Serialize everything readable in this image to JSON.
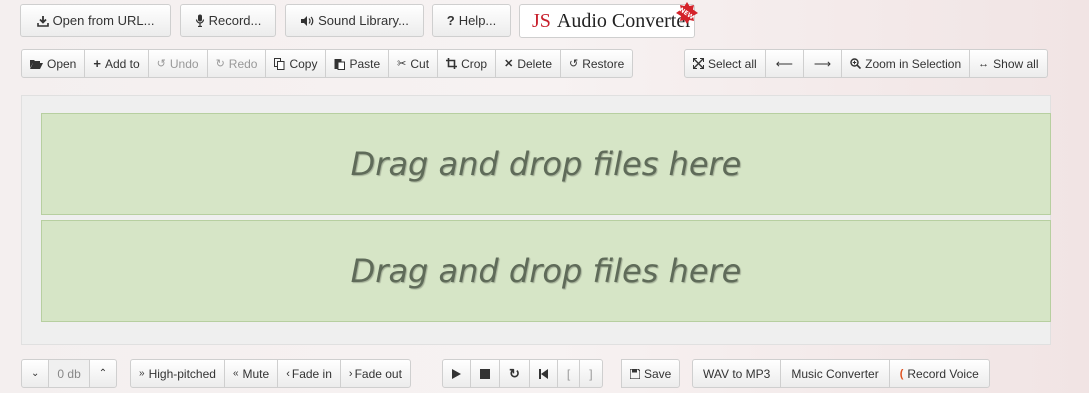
{
  "top_toolbar": {
    "open_url": "Open from URL...",
    "record": "Record...",
    "sound_library": "Sound Library...",
    "help": "Help..."
  },
  "logo": {
    "js": "JS",
    "name": "Audio Converter",
    "badge": "NEW"
  },
  "edit_toolbar": {
    "open": "Open",
    "add_to": "Add to",
    "undo": "Undo",
    "redo": "Redo",
    "copy": "Copy",
    "paste": "Paste",
    "cut": "Cut",
    "crop": "Crop",
    "delete": "Delete",
    "restore": "Restore",
    "select_all": "Select all",
    "zoom_selection": "Zoom in Selection",
    "show_all": "Show all"
  },
  "drop_zones": [
    "Drag and drop files here",
    "Drag and drop files here"
  ],
  "bottom_toolbar": {
    "volume": "0 db",
    "high_pitched": "High-pitched",
    "mute": "Mute",
    "fade_in": "Fade in",
    "fade_out": "Fade out",
    "sel_start": "[",
    "sel_end": "]",
    "save": "Save",
    "wav_to_mp3": "WAV to MP3",
    "music_converter": "Music Converter",
    "record_voice": "Record Voice"
  },
  "colors": {
    "logo_js": "#c8202d",
    "drop_bg": "#d6e5c6",
    "record_voice_icon": "#e0501e"
  }
}
